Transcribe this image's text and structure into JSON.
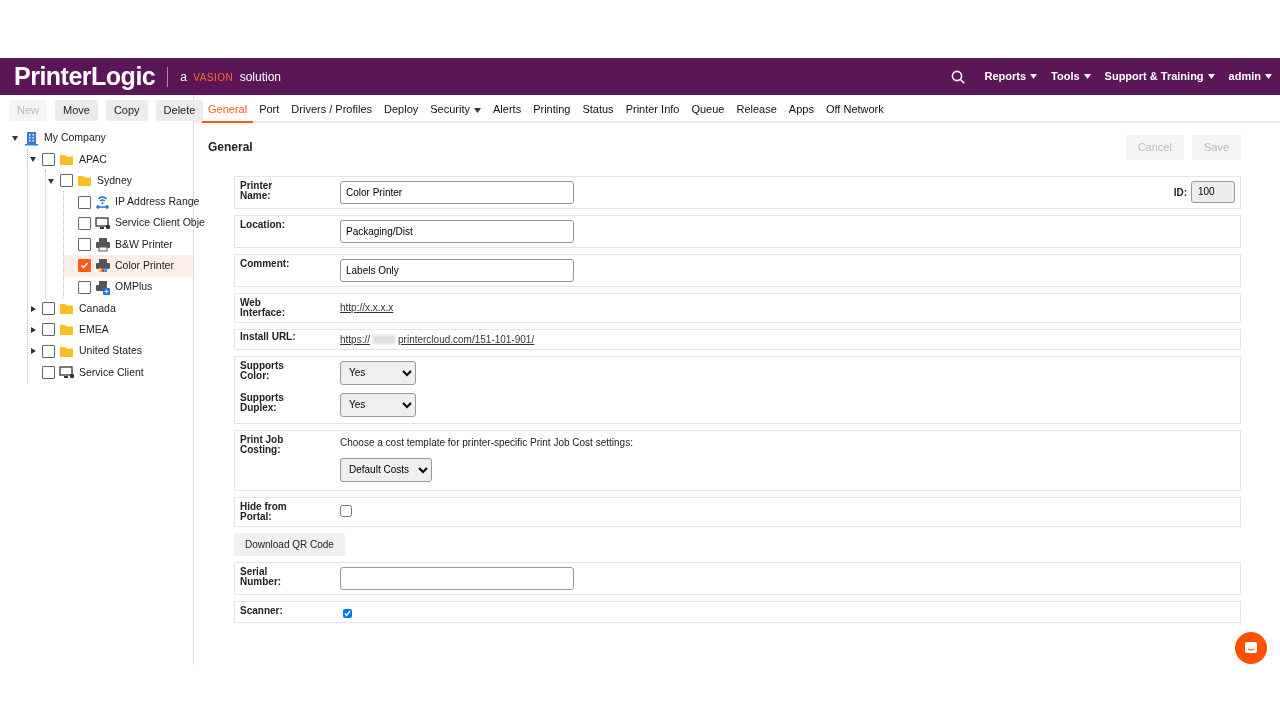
{
  "header": {
    "logo_main": "PrinterLogic",
    "logo_tagline_prefix": "a",
    "logo_brand": "VASION",
    "logo_tagline_suffix": "solution",
    "menus": [
      {
        "label": "Reports"
      },
      {
        "label": "Tools"
      },
      {
        "label": "Support & Training"
      },
      {
        "label": "admin"
      }
    ]
  },
  "toolbar": [
    {
      "label": "New",
      "disabled": true
    },
    {
      "label": "Move",
      "disabled": false
    },
    {
      "label": "Copy",
      "disabled": false
    },
    {
      "label": "Delete",
      "disabled": false
    }
  ],
  "tree": [
    {
      "label": "My Company",
      "kind": "company",
      "expanded": true,
      "children": [
        {
          "label": "APAC",
          "kind": "folder",
          "checked": false,
          "selected": false,
          "expanded": true,
          "children": [
            {
              "label": "Sydney",
              "kind": "folder",
              "checked": false,
              "selected": false,
              "expanded": true,
              "children": [
                {
                  "label": "IP Address Range",
                  "kind": "ip-range",
                  "checked": false,
                  "selected": false
                },
                {
                  "label": "Service Client Obje",
                  "kind": "service-client",
                  "checked": false,
                  "selected": false
                },
                {
                  "label": "B&W Printer",
                  "kind": "printer",
                  "checked": false,
                  "selected": false
                },
                {
                  "label": "Color Printer",
                  "kind": "color-printer",
                  "checked": true,
                  "selected": true
                },
                {
                  "label": "OMPlus",
                  "kind": "omplus",
                  "checked": false,
                  "selected": false
                }
              ]
            }
          ]
        },
        {
          "label": "Canada",
          "kind": "folder",
          "checked": false,
          "selected": false,
          "expanded": false
        },
        {
          "label": "EMEA",
          "kind": "folder",
          "checked": false,
          "selected": false,
          "expanded": false
        },
        {
          "label": "United States",
          "kind": "folder",
          "checked": false,
          "selected": false,
          "expanded": false
        },
        {
          "label": "Service Client",
          "kind": "service-client",
          "checked": false,
          "selected": false
        }
      ]
    }
  ],
  "tabs": [
    {
      "label": "General",
      "selected": true
    },
    {
      "label": "Port",
      "selected": false
    },
    {
      "label": "Drivers / Profiles",
      "selected": false
    },
    {
      "label": "Deploy",
      "selected": false
    },
    {
      "label": "Security",
      "selected": false,
      "dropdown": true
    },
    {
      "label": "Alerts",
      "selected": false
    },
    {
      "label": "Printing",
      "selected": false
    },
    {
      "label": "Status",
      "selected": false
    },
    {
      "label": "Printer Info",
      "selected": false
    },
    {
      "label": "Queue",
      "selected": false
    },
    {
      "label": "Release",
      "selected": false
    },
    {
      "label": "Apps",
      "selected": false
    },
    {
      "label": "Off Network",
      "selected": false
    }
  ],
  "section_title": "General",
  "actions": [
    {
      "label": "Cancel",
      "disabled": true
    },
    {
      "label": "Save",
      "disabled": true
    }
  ],
  "rows": [
    {
      "kind": "text",
      "label": "Printer Name:",
      "value": "Color Printer",
      "id_label": "ID:",
      "id_value": "100"
    },
    {
      "kind": "text",
      "label": "Location:",
      "value": "Packaging/Dist"
    },
    {
      "kind": "text",
      "label": "Comment:",
      "value": "Labels Only"
    },
    {
      "kind": "link",
      "label": "Web Interface:",
      "value": "http://x.x.x.x"
    },
    {
      "kind": "url",
      "label": "Install URL:",
      "prefix": "https://",
      "value": "printercloud.com/151-101-901/"
    },
    {
      "kind": "selects",
      "items": [
        {
          "label": "Supports Color:",
          "value": "Yes"
        },
        {
          "label": "Supports Duplex:",
          "value": "Yes"
        }
      ]
    },
    {
      "kind": "costing",
      "label": "Print Job Costing:",
      "note": "Choose a cost template for printer-specific Print Job Cost settings:",
      "value": "Default Costs"
    },
    {
      "kind": "checkbox",
      "label": "Hide from Portal:",
      "checked": false
    },
    {
      "kind": "button",
      "label": "Download QR Code"
    },
    {
      "kind": "text",
      "label": "Serial Number:",
      "value": ""
    },
    {
      "kind": "small-checkbox",
      "label": "Scanner:",
      "checked": true
    }
  ]
}
